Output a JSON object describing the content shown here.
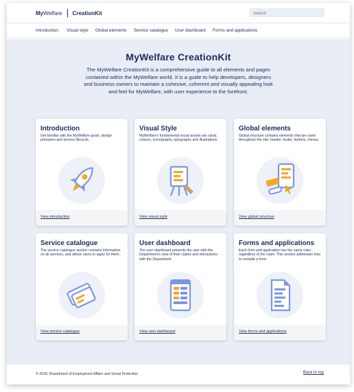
{
  "header": {
    "brand_my": "My",
    "brand_welfare": "Welfare",
    "brand_creationkit": "CreationKit",
    "search_placeholder": "Search"
  },
  "nav": {
    "items": [
      "Introduction",
      "Visual style",
      "Global elements",
      "Service catalogue",
      "User dashboard",
      "Forms and applications"
    ]
  },
  "hero": {
    "title": "MyWelfare CreationKit",
    "description": "The MyWelfare CreationKit is a comprehensive guide to all elements and pages contained within the MyWelfare world. It is a guide to help developers, designers and business owners to maintain a cohesive, coherent and visually appealing look and feel for MyWelfare, with user experience to the forefront."
  },
  "cards": [
    {
      "title": "Introduction",
      "text": "Get familiar with the MyWelfare goals, design principles and service lifecycle.",
      "link": "View introduction",
      "icon": "rocket-icon"
    },
    {
      "title": "Visual Style",
      "text": "MyWelfare's fundamental visual assets are cards, colours, iconography, typography and illustrations.",
      "link": "View visual style",
      "icon": "easel-icon"
    },
    {
      "title": "Global elements",
      "text": "Global structure contains elements that are used throughout the site; header, footer, buttons, menus.",
      "link": "View global structure",
      "icon": "ui-elements-icon"
    },
    {
      "title": "Service catalogue",
      "text": "The service catalogue section contains information on all services, and allows users to apply for them.",
      "link": "View service catalogue",
      "icon": "cards-icon"
    },
    {
      "title": "User dashboard",
      "text": "The user dashboard presents the user with the Department's view of their claims and interactions with the Department.",
      "link": "View user dashboard",
      "icon": "dashboard-icon"
    },
    {
      "title": "Forms and applications",
      "text": "Each form and application has the same rules regardless of the claim. This section addresses how to compile a form.",
      "link": "View forms and applications",
      "icon": "document-icon"
    }
  ],
  "footer": {
    "copyright": "© 2018, Department of Employment Affairs and Social Protection",
    "back_to_top": "Back to top"
  },
  "colors": {
    "navy": "#1d2b5a",
    "background": "#e9edf6",
    "orange": "#f5a623",
    "blue": "#7b96e8"
  }
}
